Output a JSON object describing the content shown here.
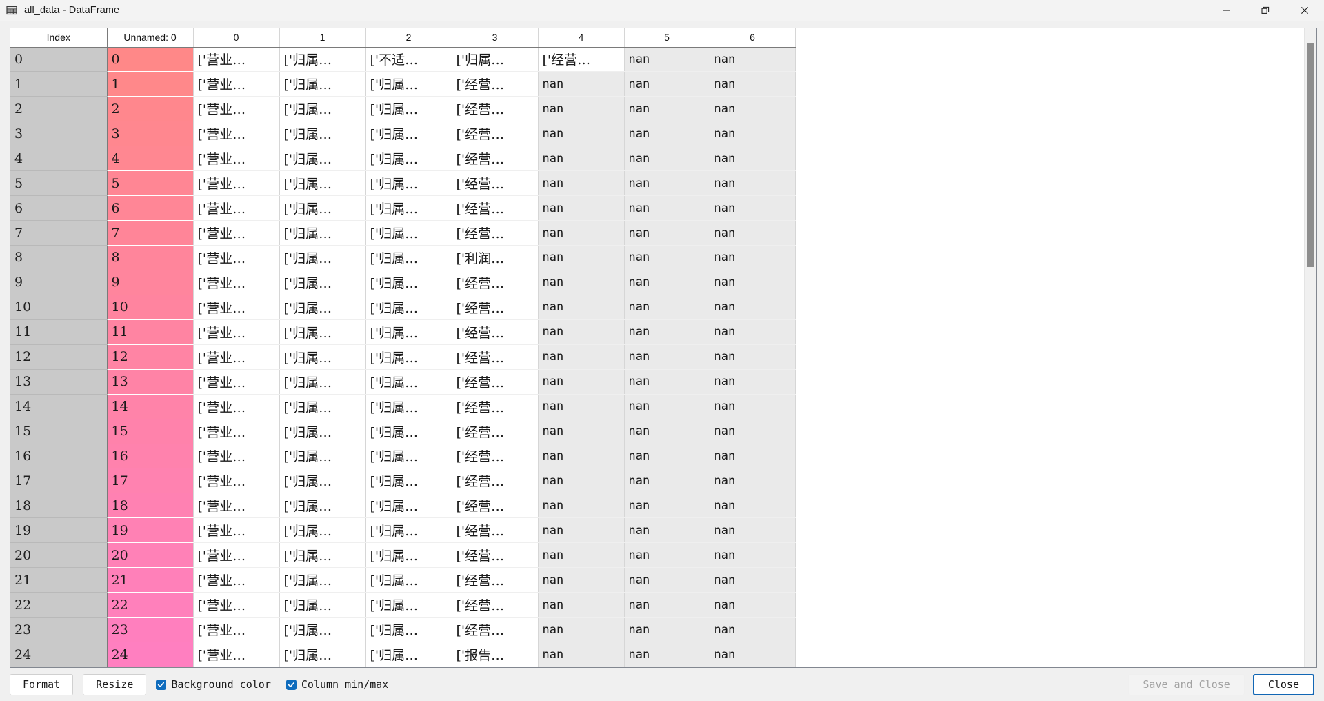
{
  "window": {
    "title": "all_data - DataFrame",
    "icon": "table-grid-icon",
    "controls": {
      "minimize": "minimize-icon",
      "restore": "restore-icon",
      "close": "close-icon"
    }
  },
  "table": {
    "columns": [
      "Index",
      "Unnamed: 0",
      "0",
      "1",
      "2",
      "3",
      "4",
      "5",
      "6"
    ],
    "rows": [
      {
        "index": "0",
        "unnamed": "0",
        "cells": [
          "['营业…",
          "['归属…",
          "['不适…",
          "['归属…",
          "['经营…",
          "nan",
          "nan"
        ]
      },
      {
        "index": "1",
        "unnamed": "1",
        "cells": [
          "['营业…",
          "['归属…",
          "['归属…",
          "['经营…",
          "nan",
          "nan",
          "nan"
        ]
      },
      {
        "index": "2",
        "unnamed": "2",
        "cells": [
          "['营业…",
          "['归属…",
          "['归属…",
          "['经营…",
          "nan",
          "nan",
          "nan"
        ]
      },
      {
        "index": "3",
        "unnamed": "3",
        "cells": [
          "['营业…",
          "['归属…",
          "['归属…",
          "['经营…",
          "nan",
          "nan",
          "nan"
        ]
      },
      {
        "index": "4",
        "unnamed": "4",
        "cells": [
          "['营业…",
          "['归属…",
          "['归属…",
          "['经营…",
          "nan",
          "nan",
          "nan"
        ]
      },
      {
        "index": "5",
        "unnamed": "5",
        "cells": [
          "['营业…",
          "['归属…",
          "['归属…",
          "['经营…",
          "nan",
          "nan",
          "nan"
        ]
      },
      {
        "index": "6",
        "unnamed": "6",
        "cells": [
          "['营业…",
          "['归属…",
          "['归属…",
          "['经营…",
          "nan",
          "nan",
          "nan"
        ]
      },
      {
        "index": "7",
        "unnamed": "7",
        "cells": [
          "['营业…",
          "['归属…",
          "['归属…",
          "['经营…",
          "nan",
          "nan",
          "nan"
        ]
      },
      {
        "index": "8",
        "unnamed": "8",
        "cells": [
          "['营业…",
          "['归属…",
          "['归属…",
          "['利润…",
          "nan",
          "nan",
          "nan"
        ]
      },
      {
        "index": "9",
        "unnamed": "9",
        "cells": [
          "['营业…",
          "['归属…",
          "['归属…",
          "['经营…",
          "nan",
          "nan",
          "nan"
        ]
      },
      {
        "index": "10",
        "unnamed": "10",
        "cells": [
          "['营业…",
          "['归属…",
          "['归属…",
          "['经营…",
          "nan",
          "nan",
          "nan"
        ]
      },
      {
        "index": "11",
        "unnamed": "11",
        "cells": [
          "['营业…",
          "['归属…",
          "['归属…",
          "['经营…",
          "nan",
          "nan",
          "nan"
        ]
      },
      {
        "index": "12",
        "unnamed": "12",
        "cells": [
          "['营业…",
          "['归属…",
          "['归属…",
          "['经营…",
          "nan",
          "nan",
          "nan"
        ]
      },
      {
        "index": "13",
        "unnamed": "13",
        "cells": [
          "['营业…",
          "['归属…",
          "['归属…",
          "['经营…",
          "nan",
          "nan",
          "nan"
        ]
      },
      {
        "index": "14",
        "unnamed": "14",
        "cells": [
          "['营业…",
          "['归属…",
          "['归属…",
          "['经营…",
          "nan",
          "nan",
          "nan"
        ]
      },
      {
        "index": "15",
        "unnamed": "15",
        "cells": [
          "['营业…",
          "['归属…",
          "['归属…",
          "['经营…",
          "nan",
          "nan",
          "nan"
        ]
      },
      {
        "index": "16",
        "unnamed": "16",
        "cells": [
          "['营业…",
          "['归属…",
          "['归属…",
          "['经营…",
          "nan",
          "nan",
          "nan"
        ]
      },
      {
        "index": "17",
        "unnamed": "17",
        "cells": [
          "['营业…",
          "['归属…",
          "['归属…",
          "['经营…",
          "nan",
          "nan",
          "nan"
        ]
      },
      {
        "index": "18",
        "unnamed": "18",
        "cells": [
          "['营业…",
          "['归属…",
          "['归属…",
          "['经营…",
          "nan",
          "nan",
          "nan"
        ]
      },
      {
        "index": "19",
        "unnamed": "19",
        "cells": [
          "['营业…",
          "['归属…",
          "['归属…",
          "['经营…",
          "nan",
          "nan",
          "nan"
        ]
      },
      {
        "index": "20",
        "unnamed": "20",
        "cells": [
          "['营业…",
          "['归属…",
          "['归属…",
          "['经营…",
          "nan",
          "nan",
          "nan"
        ]
      },
      {
        "index": "21",
        "unnamed": "21",
        "cells": [
          "['营业…",
          "['归属…",
          "['归属…",
          "['经营…",
          "nan",
          "nan",
          "nan"
        ]
      },
      {
        "index": "22",
        "unnamed": "22",
        "cells": [
          "['营业…",
          "['归属…",
          "['归属…",
          "['经营…",
          "nan",
          "nan",
          "nan"
        ]
      },
      {
        "index": "23",
        "unnamed": "23",
        "cells": [
          "['营业…",
          "['归属…",
          "['归属…",
          "['经营…",
          "nan",
          "nan",
          "nan"
        ]
      },
      {
        "index": "24",
        "unnamed": "24",
        "cells": [
          "['营业…",
          "['归属…",
          "['归属…",
          "['报告…",
          "nan",
          "nan",
          "nan"
        ]
      }
    ],
    "gradient": {
      "top_color": "#FF8888",
      "bottom_color": "#FF7FC0"
    },
    "nan_cell_color": "#EAEAEA",
    "index_cell_color": "#C9C9C9"
  },
  "toolbar": {
    "format_label": "Format",
    "resize_label": "Resize",
    "background_color_label": "Background color",
    "background_color_checked": true,
    "column_minmax_label": "Column min/max",
    "column_minmax_checked": true,
    "save_and_close_label": "Save and Close",
    "save_and_close_enabled": false,
    "close_label": "Close",
    "accent_color": "#0F6CBD",
    "focus_color": "#1267B5"
  }
}
